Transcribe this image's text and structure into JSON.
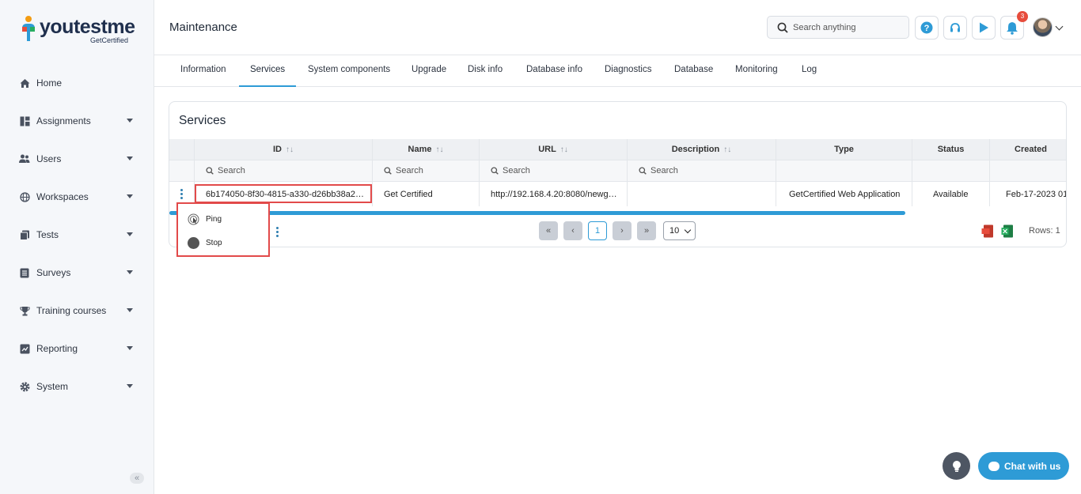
{
  "brand": {
    "name": "youtestme",
    "tagline": "GetCertified"
  },
  "sidebar": {
    "items": [
      {
        "label": "Home",
        "icon": "home-icon"
      },
      {
        "label": "Assignments",
        "icon": "assignments-icon"
      },
      {
        "label": "Users",
        "icon": "users-icon"
      },
      {
        "label": "Workspaces",
        "icon": "globe-icon"
      },
      {
        "label": "Tests",
        "icon": "tests-icon"
      },
      {
        "label": "Surveys",
        "icon": "surveys-icon"
      },
      {
        "label": "Training courses",
        "icon": "trophy-icon"
      },
      {
        "label": "Reporting",
        "icon": "reporting-icon"
      },
      {
        "label": "System",
        "icon": "gear-icon"
      }
    ],
    "collapse_glyph": "«"
  },
  "header": {
    "title": "Maintenance",
    "search_placeholder": "Search anything",
    "notification_count": "3"
  },
  "tabs": [
    "Information",
    "Services",
    "System components",
    "Upgrade",
    "Disk info",
    "Database info",
    "Diagnostics",
    "Database",
    "Monitoring",
    "Log"
  ],
  "active_tab": "Services",
  "services": {
    "title": "Services",
    "columns": [
      "ID",
      "Name",
      "URL",
      "Description",
      "Type",
      "Status",
      "Created"
    ],
    "sort_glyph": "↑↓",
    "search_placeholder": "Search",
    "rows": [
      {
        "id": "6b174050-8f30-4815-a330-d26bb38a2…",
        "name": "Get Certified",
        "url": "http://192.168.4.20:8080/newg…",
        "description": "",
        "type": "GetCertified Web Application",
        "status": "Available",
        "created": "Feb-17-2023 01:"
      }
    ],
    "pagination": {
      "first": "«",
      "prev": "‹",
      "current": "1",
      "next": "›",
      "last": "»",
      "page_size": "10",
      "rows_label": "Rows: 1"
    }
  },
  "context_menu": {
    "items": [
      "Ping",
      "Stop"
    ]
  },
  "chat": {
    "label": "Chat with us"
  },
  "colors": {
    "accent": "#2e9bd6",
    "highlight": "#e24a4a",
    "sidebar_bg": "#f5f7fa"
  }
}
